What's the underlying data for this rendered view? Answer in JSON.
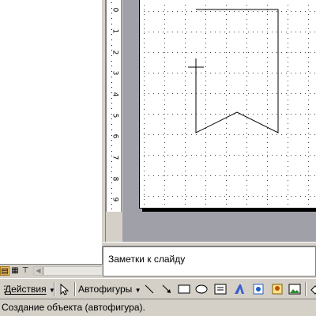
{
  "notes": {
    "placeholder": "Заметки к слайду"
  },
  "toolbar": {
    "actions_label": "Действия",
    "autoshapes_label": "Автофигуры"
  },
  "status": {
    "text": "Создание объекта (автофигура)."
  },
  "ruler": {
    "labels": [
      "0",
      "1",
      "2",
      "3",
      "4",
      "5",
      "6",
      "7",
      "8",
      "9"
    ]
  },
  "view_buttons": [
    {
      "name": "normal-view",
      "icon": "normal-view-icon"
    },
    {
      "name": "slide-sorter-view",
      "icon": "slide-sorter-icon"
    },
    {
      "name": "slide-show-view",
      "icon": "slide-show-icon"
    }
  ],
  "colors": {
    "workspace": "#a0a0a8",
    "chrome": "#d4d0c8",
    "active_view": "#f0c36a"
  }
}
